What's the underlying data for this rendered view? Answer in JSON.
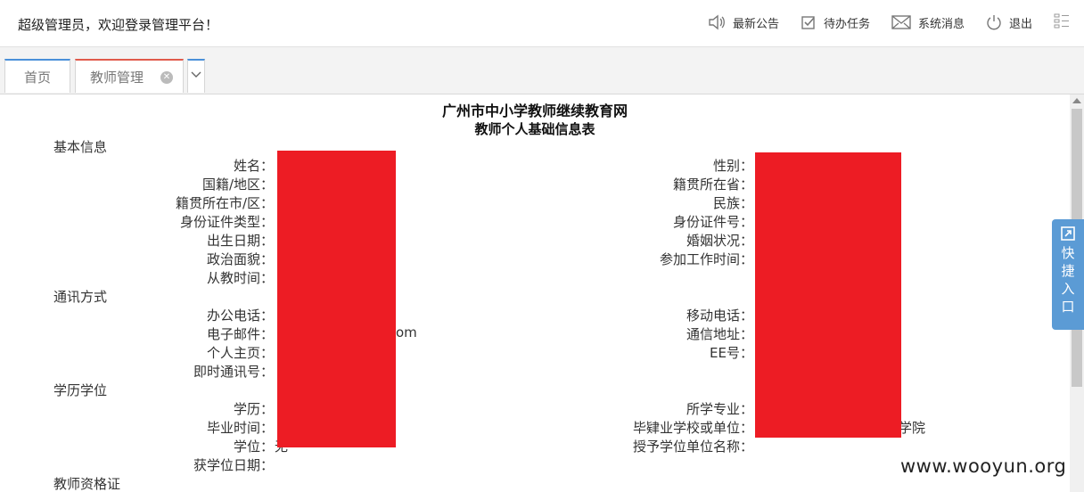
{
  "header": {
    "welcome": "超级管理员，欢迎登录管理平台！",
    "nav": {
      "announcement": "最新公告",
      "todo": "待办任务",
      "messages": "系统消息",
      "logout": "退出"
    }
  },
  "tabs": {
    "home": "首页",
    "teacher": "教师管理"
  },
  "page": {
    "title": "广州市中小学教师继续教育网",
    "subtitle": "教师个人基础信息表"
  },
  "sections": {
    "basic": "基本信息",
    "contact": "通讯方式",
    "education": "学历学位",
    "certificate": "教师资格证"
  },
  "basic": {
    "left": [
      "姓名：",
      "国籍/地区：",
      "籍贯所在市/区：",
      "身份证件类型：",
      "出生日期：",
      "政治面貌：",
      "从教时间："
    ],
    "right": [
      "性别：",
      "籍贯所在省：",
      "民族：",
      "身份证件号：",
      "婚姻状况：",
      "参加工作时间："
    ]
  },
  "contact": {
    "left": [
      "办公电话：",
      "电子邮件：",
      "个人主页：",
      "即时通讯号："
    ],
    "right": [
      "移动电话：",
      "通信地址：",
      "EE号："
    ],
    "email_tail": "om"
  },
  "education": {
    "left": [
      "学历：",
      "毕业时间：",
      "学位：",
      "获学位日期："
    ],
    "right": [
      "所学专业：",
      "毕肄业学校或单位：",
      "授予学位单位名称："
    ],
    "school_tail": "学院",
    "degree_value": "无"
  },
  "quick_entry": [
    "快",
    "捷",
    "入",
    "口"
  ],
  "watermark": "www.wooyun.org",
  "colors": {
    "redaction": "#ed1c24",
    "quick_entry": "#5b9bd5",
    "home_tab_accent": "#4a90d9",
    "active_tab_accent": "#e05a4b"
  }
}
